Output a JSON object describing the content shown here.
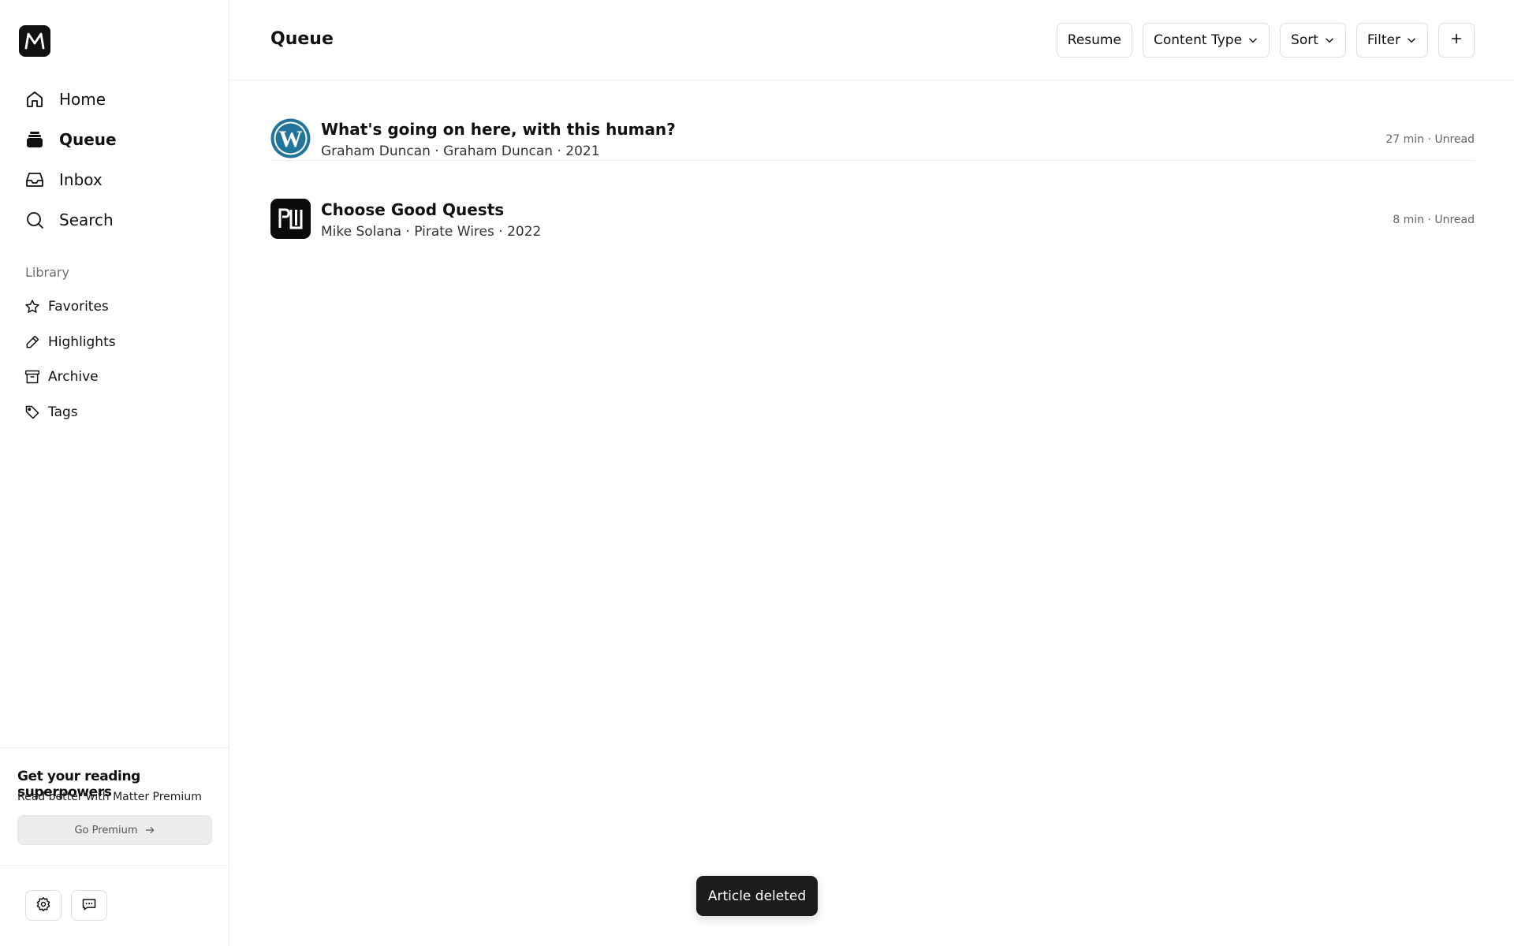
{
  "sidebar": {
    "nav": [
      {
        "label": "Home",
        "icon": "home-icon"
      },
      {
        "label": "Queue",
        "icon": "stack-icon"
      },
      {
        "label": "Inbox",
        "icon": "inbox-icon"
      },
      {
        "label": "Search",
        "icon": "search-icon"
      }
    ],
    "library_title": "Library",
    "library": [
      {
        "label": "Favorites",
        "icon": "star-icon"
      },
      {
        "label": "Highlights",
        "icon": "pen-icon"
      },
      {
        "label": "Archive",
        "icon": "archive-icon"
      },
      {
        "label": "Tags",
        "icon": "tag-icon"
      }
    ],
    "promo": {
      "title": "Get your reading superpowers",
      "subtitle": "Read better with Matter Premium",
      "button": "Go Premium"
    }
  },
  "header": {
    "title": "Queue",
    "resume": "Resume",
    "content_type": "Content Type",
    "sort": "Sort",
    "filter": "Filter"
  },
  "articles": [
    {
      "title": "What's going on here, with this human?",
      "meta": "Graham Duncan · Graham Duncan · 2021",
      "right": "27 min · Unread",
      "icon": "wordpress-icon"
    },
    {
      "title": "Choose Good Quests",
      "meta": "Mike Solana · Pirate Wires · 2022",
      "right": "8 min · Unread",
      "icon": "pirate-wires-icon"
    }
  ],
  "toast": "Article deleted",
  "colors": {
    "accent": "#111111",
    "wordpress": "#21759b",
    "toast_bg": "#1c1c1c"
  }
}
